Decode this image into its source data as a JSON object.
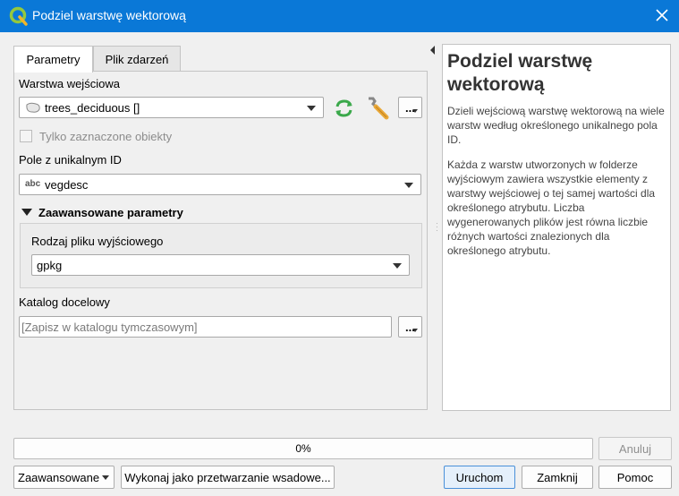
{
  "window": {
    "title": "Podziel warstwę wektorową"
  },
  "tabs": [
    {
      "label": "Parametry",
      "active": true
    },
    {
      "label": "Plik zdarzeń",
      "active": false
    }
  ],
  "params": {
    "input_layer_label": "Warstwa wejściowa",
    "input_layer_value": "trees_deciduous []",
    "selected_only_label": "Tylko zaznaczone obiekty",
    "selected_only_checked": false,
    "id_field_label": "Pole z unikalnym ID",
    "id_field_type": "abc",
    "id_field_value": "vegdesc",
    "advanced_header": "Zaawansowane parametry",
    "output_type_label": "Rodzaj pliku wyjściowego",
    "output_type_value": "gpkg",
    "output_dir_label": "Katalog docelowy",
    "output_dir_placeholder": "[Zapisz w katalogu tymczasowym]",
    "browse_label": "..."
  },
  "help": {
    "title": "Podziel warstwę wektorową",
    "paragraph1": "Dzieli wejściową warstwę wektorową na wiele warstw według określonego unikalnego pola ID.",
    "paragraph2": "Każda z warstw utworzonych w folderze wyjściowym zawiera wszystkie elementy z warstwy wejściowej o tej samej wartości dla określonego atrybutu. Liczba wygenerowanych plików jest równa liczbie różnych wartości znalezionych dla określonego atrybutu."
  },
  "footer": {
    "progress_text": "0%",
    "progress_fraction": 0,
    "cancel_label": "Anuluj",
    "advanced_label": "Zaawansowane",
    "batch_label": "Wykonaj jako przetwarzanie wsadowe...",
    "run_label": "Uruchom",
    "close_label": "Zamknij",
    "help_label": "Pomoc"
  },
  "colors": {
    "titlebar": "#0a78d7",
    "accent_icon": "#3aa84a"
  }
}
